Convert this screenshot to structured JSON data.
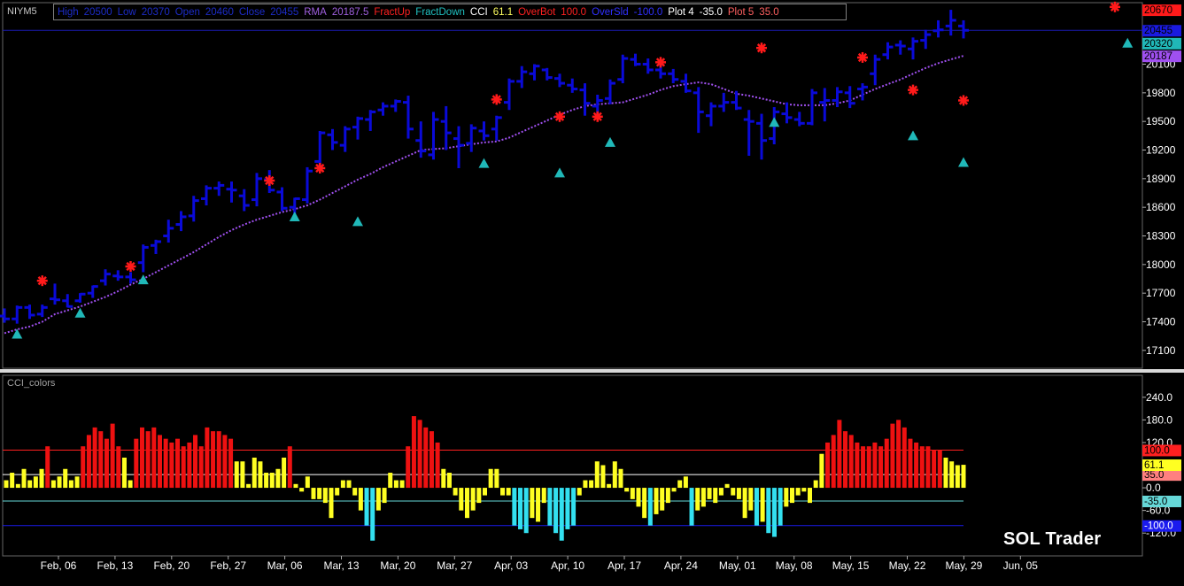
{
  "symbol": "NIYM5",
  "indicator_title": "CCI_colors",
  "brand": "SOL Trader",
  "legend": [
    {
      "text": "High",
      "color": "#1c2cc8"
    },
    {
      "text": "20500",
      "color": "#1c2cc8"
    },
    {
      "text": "Low",
      "color": "#1c2cc8"
    },
    {
      "text": "20370",
      "color": "#1c2cc8"
    },
    {
      "text": "Open",
      "color": "#1c2cc8"
    },
    {
      "text": "20460",
      "color": "#1c2cc8"
    },
    {
      "text": "Close",
      "color": "#1c2cc8"
    },
    {
      "text": "20455",
      "color": "#1c2cc8"
    },
    {
      "text": "RMA",
      "color": "#a060e0"
    },
    {
      "text": "20187.5",
      "color": "#a060e0"
    },
    {
      "text": "FractUp",
      "color": "#ff2020"
    },
    {
      "text": "FractDown",
      "color": "#20c0c0"
    },
    {
      "text": "CCI",
      "color": "#ffffff"
    },
    {
      "text": "61.1",
      "color": "#ffff60"
    },
    {
      "text": "OverBot",
      "color": "#ff2020"
    },
    {
      "text": "100.0",
      "color": "#ff2020"
    },
    {
      "text": "OverSld",
      "color": "#3030ff"
    },
    {
      "text": "-100.0",
      "color": "#3030ff"
    },
    {
      "text": "Plot 4",
      "color": "#ffffff"
    },
    {
      "text": "-35.0",
      "color": "#ffffff"
    },
    {
      "text": "Plot 5",
      "color": "#ff6060"
    },
    {
      "text": "35.0",
      "color": "#ff6060"
    }
  ],
  "colors": {
    "bars": "#0a0ad8",
    "rma": "#a050f0",
    "fract_up": "#ff1a1a",
    "fract_down": "#20b8b8",
    "cci_red": "#ee1111",
    "cci_yellow": "#ffff22",
    "cci_cyan": "#33e0f0",
    "overbot": "#ff2020",
    "oversold": "#1a1aee",
    "plot4": "#66d8d8",
    "plot5": "#ffffff",
    "last_line": "#1a1ab0"
  },
  "chart_data": [
    {
      "type": "ohlc",
      "title": "NIYM5",
      "x_dates": [
        "Feb, 06",
        "Feb, 13",
        "Feb, 20",
        "Feb, 27",
        "Mar, 06",
        "Mar, 13",
        "Mar, 20",
        "Mar, 27",
        "Apr, 03",
        "Apr, 10",
        "Apr, 17",
        "Apr, 24",
        "May, 01",
        "May, 08",
        "May, 15",
        "May, 22",
        "May, 29",
        "Jun, 05"
      ],
      "y_ticks": [
        17100,
        17400,
        17700,
        18000,
        18300,
        18600,
        18900,
        19200,
        19500,
        19800,
        20100
      ],
      "ylim": [
        16950,
        20680
      ],
      "last_values": [
        {
          "label": "20670",
          "color": "#ff1a1a",
          "value": 20670
        },
        {
          "label": "20455",
          "color": "#1a1ae0",
          "value": 20455
        },
        {
          "label": "20320",
          "color": "#20b8b8",
          "value": 20320
        },
        {
          "label": "20187",
          "color": "#a050f0",
          "value": 20187
        }
      ],
      "series": [
        {
          "name": "RMA",
          "values": [
            17280,
            17320,
            17350,
            17400,
            17480,
            17520,
            17560,
            17610,
            17660,
            17720,
            17790,
            17850,
            17920,
            17990,
            18060,
            18130,
            18210,
            18290,
            18360,
            18420,
            18470,
            18510,
            18550,
            18580,
            18620,
            18680,
            18750,
            18820,
            18890,
            18950,
            19020,
            19080,
            19140,
            19200,
            19210,
            19220,
            19240,
            19260,
            19280,
            19290,
            19330,
            19390,
            19450,
            19510,
            19570,
            19620,
            19660,
            19680,
            19690,
            19700,
            19740,
            19780,
            19830,
            19870,
            19890,
            19910,
            19890,
            19840,
            19790,
            19770,
            19740,
            19710,
            19680,
            19670,
            19670,
            19670,
            19690,
            19720,
            19780,
            19840,
            19890,
            19940,
            20000,
            20060,
            20110,
            20150,
            20187
          ]
        }
      ],
      "ohlc": [
        [
          17460,
          17540,
          17390,
          17430
        ],
        [
          17430,
          17570,
          17380,
          17550
        ],
        [
          17550,
          17580,
          17430,
          17470
        ],
        [
          17480,
          17580,
          17450,
          17550
        ],
        [
          17640,
          17800,
          17580,
          17630
        ],
        [
          17620,
          17690,
          17550,
          17560
        ],
        [
          17620,
          17700,
          17600,
          17690
        ],
        [
          17700,
          17780,
          17650,
          17770
        ],
        [
          17830,
          17950,
          17780,
          17900
        ],
        [
          17880,
          17940,
          17830,
          17870
        ],
        [
          17870,
          17920,
          17800,
          17840
        ],
        [
          18020,
          18210,
          17920,
          18180
        ],
        [
          18200,
          18260,
          18110,
          18240
        ],
        [
          18300,
          18470,
          18230,
          18380
        ],
        [
          18420,
          18560,
          18350,
          18500
        ],
        [
          18510,
          18720,
          18450,
          18670
        ],
        [
          18690,
          18830,
          18620,
          18800
        ],
        [
          18800,
          18870,
          18720,
          18830
        ],
        [
          18790,
          18870,
          18650,
          18780
        ],
        [
          18720,
          18790,
          18560,
          18620
        ],
        [
          18680,
          18960,
          18610,
          18900
        ],
        [
          18890,
          18990,
          18750,
          18780
        ],
        [
          18760,
          18810,
          18560,
          18590
        ],
        [
          18600,
          18700,
          18460,
          18690
        ],
        [
          18680,
          19020,
          18640,
          18980
        ],
        [
          19080,
          19400,
          19000,
          19380
        ],
        [
          19360,
          19420,
          19200,
          19280
        ],
        [
          19250,
          19450,
          19180,
          19420
        ],
        [
          19440,
          19550,
          19310,
          19530
        ],
        [
          19520,
          19620,
          19400,
          19600
        ],
        [
          19620,
          19700,
          19560,
          19660
        ],
        [
          19660,
          19730,
          19600,
          19710
        ],
        [
          19700,
          19770,
          19320,
          19420
        ],
        [
          19300,
          19500,
          19120,
          19190
        ],
        [
          19150,
          19600,
          19100,
          19520
        ],
        [
          19500,
          19660,
          19200,
          19380
        ],
        [
          19320,
          19450,
          19010,
          19250
        ],
        [
          19270,
          19470,
          19180,
          19430
        ],
        [
          19400,
          19500,
          19300,
          19350
        ],
        [
          19420,
          19560,
          19300,
          19540
        ],
        [
          19700,
          19950,
          19620,
          19920
        ],
        [
          19920,
          20080,
          19850,
          20020
        ],
        [
          20000,
          20100,
          19930,
          20080
        ],
        [
          20040,
          20060,
          19930,
          19960
        ],
        [
          19950,
          20000,
          19860,
          19900
        ],
        [
          19880,
          19950,
          19800,
          19840
        ],
        [
          19830,
          19900,
          19560,
          19690
        ],
        [
          19660,
          19780,
          19580,
          19720
        ],
        [
          19740,
          19940,
          19680,
          19900
        ],
        [
          19940,
          20200,
          19900,
          20160
        ],
        [
          20150,
          20210,
          20080,
          20100
        ],
        [
          20100,
          20160,
          20000,
          20040
        ],
        [
          20040,
          20120,
          19950,
          20000
        ],
        [
          20000,
          20050,
          19900,
          19940
        ],
        [
          19920,
          20000,
          19800,
          19820
        ],
        [
          19800,
          19860,
          19380,
          19600
        ],
        [
          19560,
          19700,
          19450,
          19660
        ],
        [
          19660,
          19800,
          19600,
          19700
        ],
        [
          19700,
          19820,
          19620,
          19640
        ],
        [
          19520,
          19620,
          19140,
          19500
        ],
        [
          19480,
          19580,
          19100,
          19300
        ],
        [
          19320,
          19650,
          19260,
          19600
        ],
        [
          19580,
          19700,
          19480,
          19540
        ],
        [
          19520,
          19600,
          19450,
          19480
        ],
        [
          19480,
          19840,
          19460,
          19800
        ],
        [
          19700,
          19850,
          19500,
          19720
        ],
        [
          19720,
          19860,
          19650,
          19810
        ],
        [
          19800,
          19870,
          19640,
          19690
        ],
        [
          19840,
          19900,
          19720,
          19860
        ],
        [
          20000,
          20200,
          19880,
          20150
        ],
        [
          20200,
          20330,
          20150,
          20280
        ],
        [
          20300,
          20350,
          20200,
          20290
        ],
        [
          20260,
          20380,
          20150,
          20340
        ],
        [
          20350,
          20460,
          20260,
          20410
        ],
        [
          20450,
          20560,
          20380,
          20460
        ],
        [
          20500,
          20670,
          20400,
          20560
        ],
        [
          20500,
          20560,
          20370,
          20455
        ]
      ],
      "fract_up": [
        [
          3,
          17830
        ],
        [
          10,
          17980
        ],
        [
          21,
          18880
        ],
        [
          25,
          19010
        ],
        [
          39,
          19730
        ],
        [
          44,
          19550
        ],
        [
          47,
          19550
        ],
        [
          52,
          20120
        ],
        [
          60,
          20270
        ],
        [
          68,
          20170
        ],
        [
          72,
          19830
        ],
        [
          76,
          19720
        ],
        [
          88,
          20700
        ]
      ],
      "fract_down": [
        [
          1,
          17270
        ],
        [
          6,
          17490
        ],
        [
          11,
          17840
        ],
        [
          23,
          18500
        ],
        [
          28,
          18450
        ],
        [
          38,
          19060
        ],
        [
          44,
          18960
        ],
        [
          48,
          19280
        ],
        [
          61,
          19490
        ],
        [
          72,
          19350
        ],
        [
          76,
          19070
        ],
        [
          89,
          20320
        ]
      ]
    },
    {
      "type": "bar",
      "title": "CCI_colors",
      "y_ticks": [
        240,
        180,
        120,
        60,
        0,
        -60,
        -120
      ],
      "y_tick_labels": [
        "240.0",
        "180.0",
        "120.0",
        "60.0",
        "0.0",
        "-60.0",
        "-120.0"
      ],
      "ylim": [
        -150,
        270
      ],
      "levels": [
        {
          "name": "OverBot",
          "value": 100,
          "label": "100.0"
        },
        {
          "name": "Plot 5",
          "value": 35,
          "label": "35.0"
        },
        {
          "name": "Plot 4",
          "value": -35,
          "label": "-35.0"
        },
        {
          "name": "OverSld",
          "value": -100,
          "label": "-100.0"
        }
      ],
      "last_value": {
        "label": "61.1",
        "value": 61.1
      },
      "values": [
        20,
        40,
        10,
        50,
        20,
        30,
        50,
        110,
        20,
        30,
        50,
        20,
        30,
        110,
        140,
        160,
        150,
        130,
        170,
        110,
        80,
        20,
        130,
        160,
        150,
        160,
        140,
        130,
        120,
        130,
        110,
        120,
        140,
        110,
        160,
        150,
        150,
        140,
        130,
        70,
        70,
        10,
        80,
        70,
        40,
        40,
        50,
        80,
        110,
        10,
        -10,
        30,
        -30,
        -30,
        -40,
        -80,
        -20,
        20,
        20,
        -20,
        -60,
        -100,
        -140,
        -60,
        -40,
        40,
        20,
        20,
        110,
        190,
        180,
        160,
        150,
        120,
        50,
        40,
        -20,
        -60,
        -80,
        -60,
        -40,
        -20,
        50,
        50,
        -20,
        -20,
        -100,
        -110,
        -120,
        -80,
        -90,
        -40,
        -100,
        -120,
        -140,
        -110,
        -100,
        -20,
        20,
        20,
        70,
        60,
        10,
        70,
        50,
        -10,
        -30,
        -50,
        -80,
        -100,
        -70,
        -60,
        -40,
        -10,
        20,
        30,
        -100,
        -60,
        -50,
        -30,
        -40,
        -20,
        10,
        -20,
        -30,
        -80,
        -60,
        -100,
        -90,
        -120,
        -130,
        -100,
        -50,
        -40,
        -20,
        -10,
        -40,
        20,
        90,
        120,
        140,
        180,
        150,
        140,
        120,
        110,
        110,
        120,
        110,
        130,
        170,
        180,
        160,
        130,
        120,
        110,
        110,
        100,
        100,
        80,
        70,
        60,
        61
      ]
    }
  ]
}
